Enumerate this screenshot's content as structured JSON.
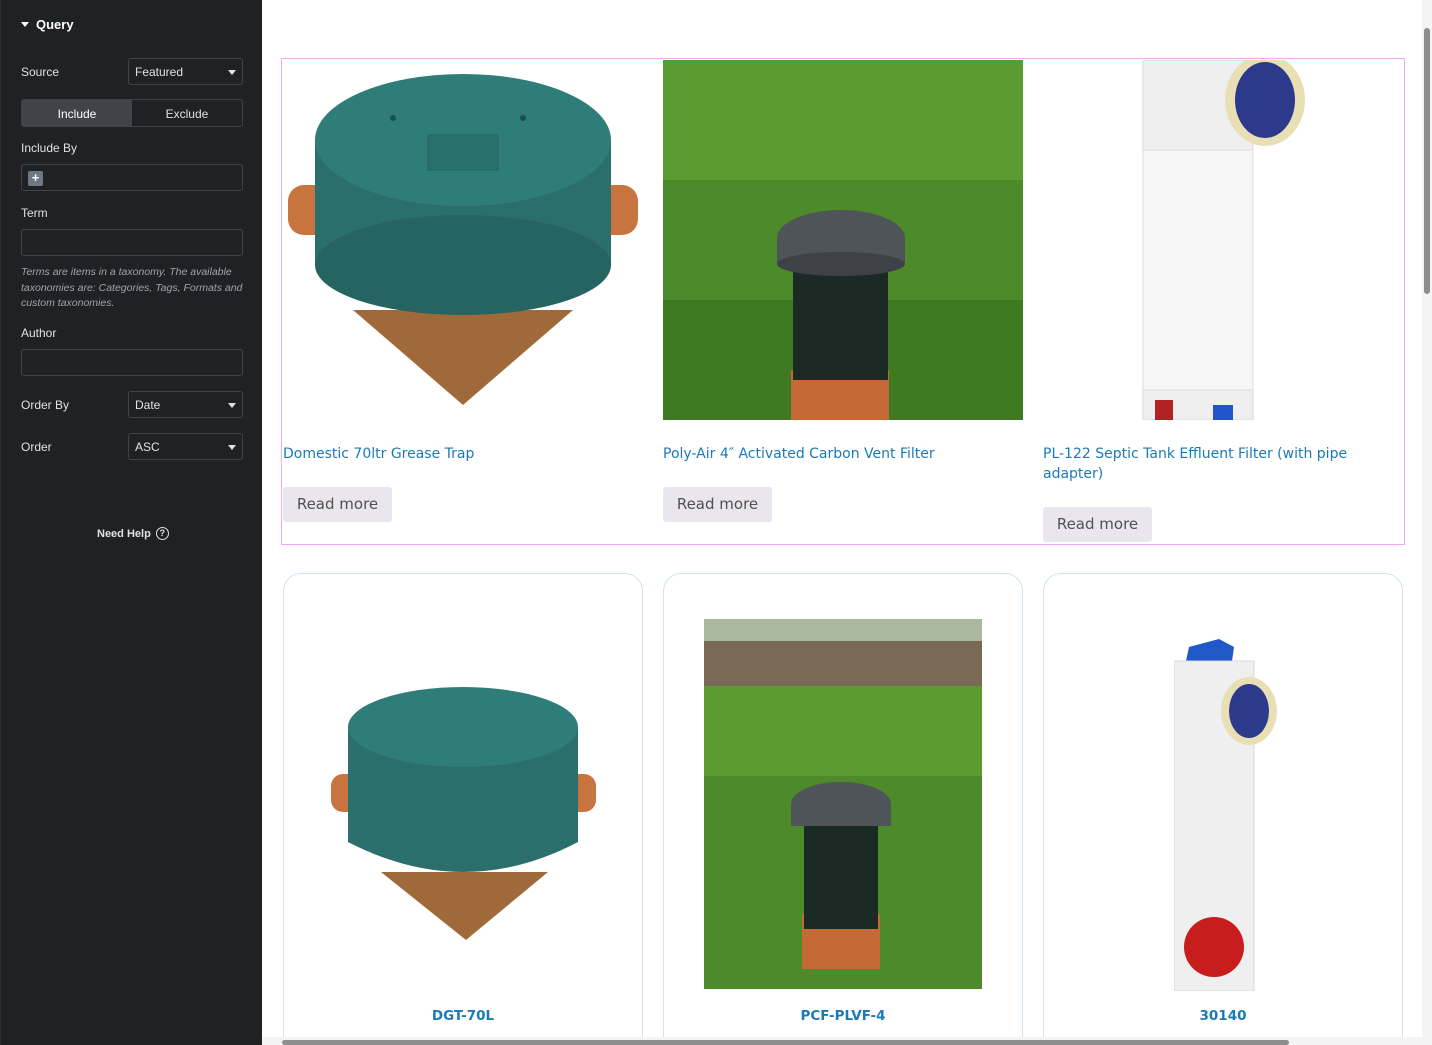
{
  "panel": {
    "section_title": "Query",
    "source": {
      "label": "Source",
      "value": "Featured"
    },
    "tabs": [
      {
        "label": "Include"
      },
      {
        "label": "Exclude"
      }
    ],
    "include_by": {
      "label": "Include By"
    },
    "term": {
      "label": "Term",
      "help": "Terms are items in a taxonomy. The available taxonomies are: Categories, Tags, Formats and custom taxonomies."
    },
    "author": {
      "label": "Author"
    },
    "order_by": {
      "label": "Order By",
      "value": "Date"
    },
    "order": {
      "label": "Order",
      "value": "ASC"
    },
    "need_help": "Need Help",
    "help_icon_glyph": "?",
    "collapse_glyph": "‹",
    "add_glyph": "+"
  },
  "products": [
    {
      "title": "Domestic 70ltr Grease Trap",
      "button": "Read more"
    },
    {
      "title": "Poly-Air 4″ Activated Carbon Vent Filter",
      "button": "Read more"
    },
    {
      "title": "PL-122 Septic Tank Effluent Filter (with pipe adapter)",
      "button": "Read more"
    }
  ],
  "cards": [
    {
      "sku": "DGT-70L"
    },
    {
      "sku": "PCF-PLVF-4"
    },
    {
      "sku": "30140"
    }
  ],
  "colors": {
    "panel_bg": "#1f2124",
    "link": "#1a7ab8",
    "selection": "#f2a8f5",
    "button_bg": "#e9e6ed",
    "grass": "#4d8a2a"
  }
}
